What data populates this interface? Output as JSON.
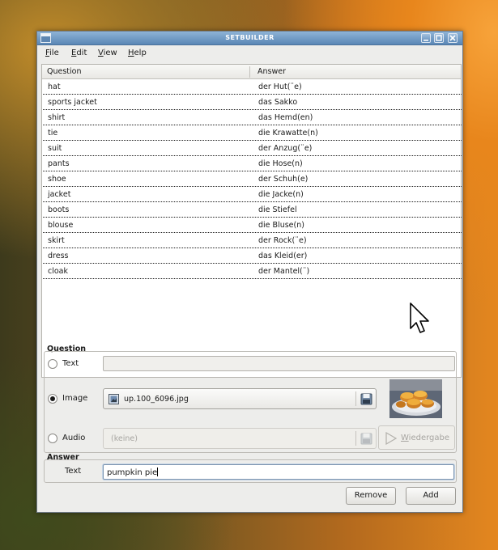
{
  "window": {
    "title": "SETBUILDER"
  },
  "menu": [
    {
      "label": "File",
      "mnemonic": "F",
      "rest": "ile"
    },
    {
      "label": "Edit",
      "mnemonic": "E",
      "rest": "dit"
    },
    {
      "label": "View",
      "mnemonic": "V",
      "rest": "iew"
    },
    {
      "label": "Help",
      "mnemonic": "H",
      "rest": "elp"
    }
  ],
  "list": {
    "headers": {
      "question": "Question",
      "answer": "Answer"
    },
    "rows": [
      {
        "question": "hat",
        "answer": "der Hut(¨e)"
      },
      {
        "question": "sports jacket",
        "answer": "das Sakko"
      },
      {
        "question": "shirt",
        "answer": "das Hemd(en)"
      },
      {
        "question": "tie",
        "answer": "die Krawatte(n)"
      },
      {
        "question": "suit",
        "answer": "der Anzug(¨e)"
      },
      {
        "question": "pants",
        "answer": "die Hose(n)"
      },
      {
        "question": "shoe",
        "answer": "der Schuh(e)"
      },
      {
        "question": "jacket",
        "answer": "die Jacke(n)"
      },
      {
        "question": "boots",
        "answer": "die Stiefel"
      },
      {
        "question": "blouse",
        "answer": "die Bluse(n)"
      },
      {
        "question": "skirt",
        "answer": "der Rock(¨e)"
      },
      {
        "question": "dress",
        "answer": "das Kleid(er)"
      },
      {
        "question": "cloak",
        "answer": "der Mantel(¨)"
      }
    ]
  },
  "question_group": {
    "title": "Question",
    "text_option": {
      "label": "Text",
      "selected": false,
      "value": ""
    },
    "image_option": {
      "label": "Image",
      "selected": true,
      "file": "up.100_6096.jpg"
    },
    "audio_option": {
      "label": "Audio",
      "selected": false,
      "file": "(keine)",
      "play_label": "Wiedergabe",
      "play_mnemonic": "W",
      "play_rest": "iedergabe"
    }
  },
  "answer_group": {
    "title": "Answer",
    "label": "Text",
    "value": "pumpkin pie"
  },
  "buttons": {
    "remove": "Remove",
    "add": "Add"
  },
  "icons": {
    "window": "window-icon",
    "minimize": "minimize-icon",
    "maximize": "maximize-icon",
    "close": "close-icon",
    "image_file": "image-file-icon",
    "open_file": "open-file-icon",
    "play": "play-icon",
    "cursor": "mouse-pointer-icon"
  },
  "colors": {
    "titlebar": "#5a87b6",
    "window_bg": "#ededeb"
  }
}
